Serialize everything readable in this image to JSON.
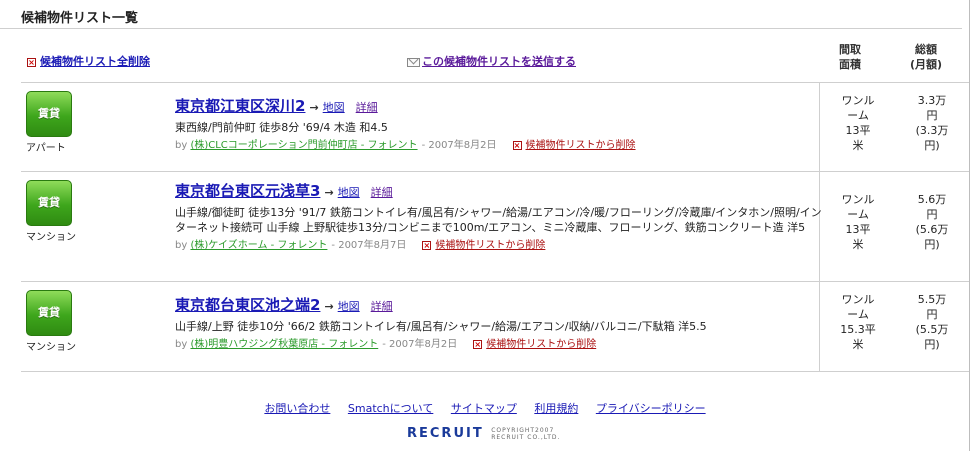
{
  "page": {
    "title": "候補物件リスト一覧"
  },
  "actions": {
    "delete_all": "候補物件リスト全削除",
    "send_list": "この候補物件リストを送信する"
  },
  "columns": {
    "size": [
      "間取",
      "面積"
    ],
    "price": [
      "総額",
      "(月額)"
    ]
  },
  "listings": [
    {
      "badge": "賃貸",
      "category": "アパート",
      "title": "東京都江東区深川2",
      "arrow": "→",
      "map_link": "地図",
      "detail_link": "詳細",
      "description": "東西線/門前仲町 徒歩8分 '69/4 木造 和4.5",
      "by": "by",
      "company": "(株)CLCコーポレーション門前仲町店 - フォレント",
      "date": "- 2007年8月2日",
      "remove": "候補物件リストから削除",
      "layout": "ワンルーム",
      "area": "13平米",
      "price": "3.3万円",
      "monthly": "(3.3万円)"
    },
    {
      "badge": "賃貸",
      "category": "マンション",
      "title": "東京都台東区元浅草3",
      "arrow": "→",
      "map_link": "地図",
      "detail_link": "詳細",
      "description": "山手線/御徒町 徒歩13分 '91/7 鉄筋コントイレ有/風呂有/シャワー/給湯/エアコン/冷/暖/フローリング/冷蔵庫/インタホン/照明/インターネット接続可 山手線 上野駅徒歩13分/コンビニまで100m/エアコン、ミニ冷蔵庫、フローリング、鉄筋コンクリート造 洋5",
      "by": "by",
      "company": "(株)ケイズホーム - フォレント",
      "date": "- 2007年8月7日",
      "remove": "候補物件リストから削除",
      "layout": "ワンルーム",
      "area": "13平米",
      "price": "5.6万円",
      "monthly": "(5.6万円)"
    },
    {
      "badge": "賃貸",
      "category": "マンション",
      "title": "東京都台東区池之端2",
      "arrow": "→",
      "map_link": "地図",
      "detail_link": "詳細",
      "description": "山手線/上野 徒歩10分 '66/2 鉄筋コントイレ有/風呂有/シャワー/給湯/エアコン/収納/バルコニ/下駄箱 洋5.5",
      "by": "by",
      "company": "(株)明豊ハウジング秋葉原店 - フォレント",
      "date": "- 2007年8月2日",
      "remove": "候補物件リストから削除",
      "layout": "ワンルーム",
      "area": "15.3平米",
      "price": "5.5万円",
      "monthly": "(5.5万円)"
    }
  ],
  "footer": {
    "links": [
      "お問い合わせ",
      "Smatchについて",
      "サイトマップ",
      "利用規約",
      "プライバシーポリシー"
    ],
    "logo": "RECRUIT",
    "copyright": [
      "COPYRIGHT2007",
      "RECRUIT CO.,LTD."
    ]
  },
  "colors": {
    "link": "#1a1ab5",
    "badge_green": "#3ea61c",
    "company_green": "#2a9a2a",
    "remove_red": "#a11111"
  }
}
